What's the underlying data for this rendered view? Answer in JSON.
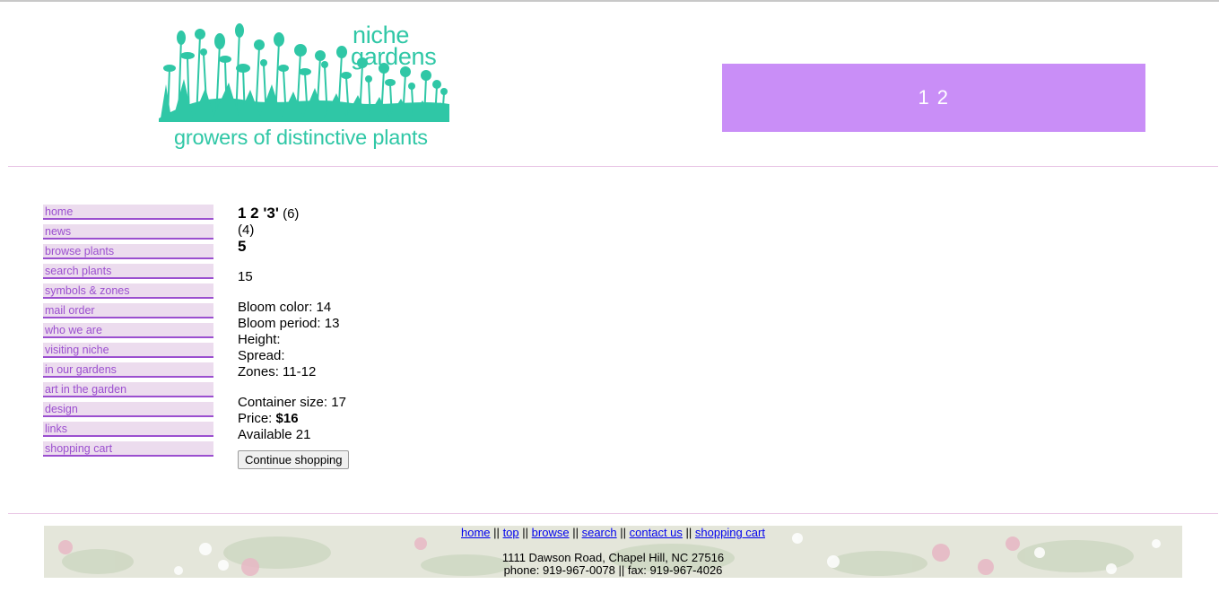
{
  "header": {
    "logo_word1": "niche",
    "logo_word2": "gardens",
    "tagline": "growers of distinctive plants",
    "banner_text": "1 2"
  },
  "sidebar": {
    "items": [
      {
        "label": "home"
      },
      {
        "label": "news"
      },
      {
        "label": "browse plants"
      },
      {
        "label": "search plants"
      },
      {
        "label": "symbols & zones"
      },
      {
        "label": "mail order"
      },
      {
        "label": "who we are"
      },
      {
        "label": "visiting niche"
      },
      {
        "label": "in our gardens"
      },
      {
        "label": "art in the garden"
      },
      {
        "label": "design"
      },
      {
        "label": "links"
      },
      {
        "label": "shopping cart"
      }
    ]
  },
  "product": {
    "name": "1 2 '3'",
    "code_a": "(6)",
    "code_b": "(4)",
    "subtitle": "5",
    "description": "15",
    "bloom_color_label": "Bloom color:",
    "bloom_color": "14",
    "bloom_period_label": "Bloom period:",
    "bloom_period": "13",
    "height_label": "Height:",
    "spread_label": "Spread:",
    "zones_label": "Zones:",
    "zones": "11-12",
    "container_label": "Container size:",
    "container": "17",
    "price_label": "Price:",
    "price": "$16",
    "available_label": "Available",
    "available": "21",
    "continue_button": "Continue shopping"
  },
  "footer": {
    "links": [
      {
        "label": "home"
      },
      {
        "label": "top"
      },
      {
        "label": "browse"
      },
      {
        "label": "search"
      },
      {
        "label": "contact us"
      },
      {
        "label": "shopping cart"
      }
    ],
    "separator": "||",
    "address": "1111 Dawson Road, Chapel Hill, NC 27516",
    "phone_line": "phone: 919-967-0078 || fax: 919-967-4026"
  },
  "colors": {
    "logo_teal": "#2fc7a6",
    "banner_purple": "#c98ef7",
    "nav_purple": "#9b4fcf",
    "nav_bg": "#ecdcee",
    "link_blue": "#0000ee"
  }
}
